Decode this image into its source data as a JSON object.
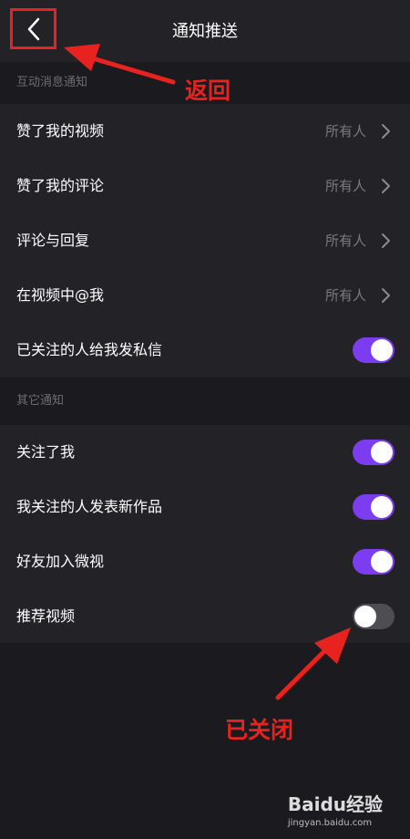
{
  "header": {
    "title": "通知推送",
    "back_icon": "chevron-left-icon"
  },
  "sections": [
    {
      "title": "互动消息通知",
      "items": [
        {
          "label": "赞了我的视频",
          "value": "所有人",
          "type": "link"
        },
        {
          "label": "赞了我的评论",
          "value": "所有人",
          "type": "link"
        },
        {
          "label": "评论与回复",
          "value": "所有人",
          "type": "link"
        },
        {
          "label": "在视频中@我",
          "value": "所有人",
          "type": "link"
        },
        {
          "label": "已关注的人给我发私信",
          "type": "toggle",
          "on": true
        }
      ]
    },
    {
      "title": "其它通知",
      "items": [
        {
          "label": "关注了我",
          "type": "toggle",
          "on": true
        },
        {
          "label": "我关注的人发表新作品",
          "type": "toggle",
          "on": true
        },
        {
          "label": "好友加入微视",
          "type": "toggle",
          "on": true
        },
        {
          "label": "推荐视频",
          "type": "toggle",
          "on": false
        }
      ]
    }
  ],
  "annotations": {
    "back_label": "返回",
    "closed_label": "已关闭"
  },
  "watermark": {
    "brand": "Baidu经验",
    "url": "jingyan.baidu.com"
  },
  "colors": {
    "background": "#232327",
    "section_bg": "#1b1b1f",
    "toggle_on": "#7c3cf0",
    "toggle_off": "#4d4d52",
    "annotation": "#e8231f"
  }
}
